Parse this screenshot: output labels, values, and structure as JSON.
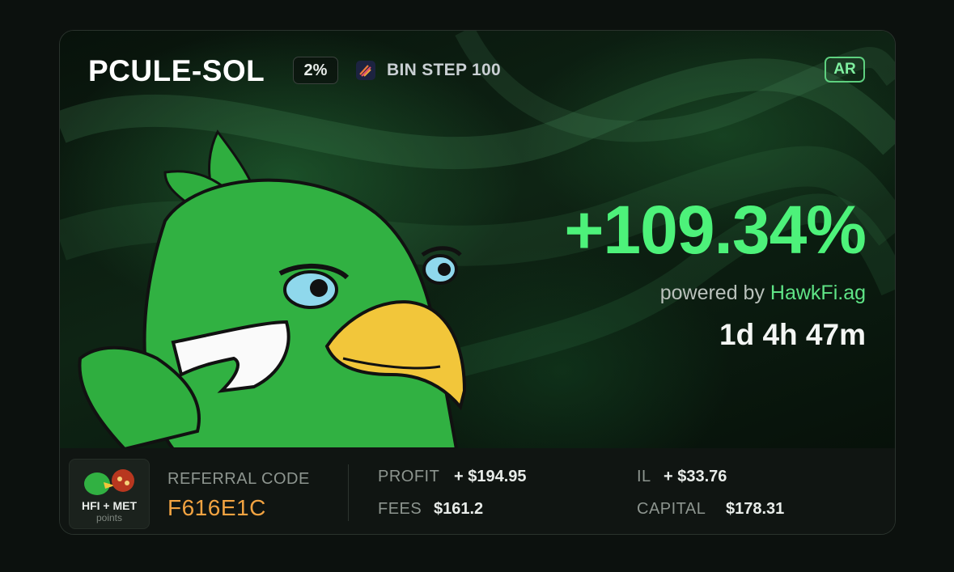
{
  "header": {
    "pair": "PCULE-SOL",
    "fee_badge": "2%",
    "bin_step": "BIN STEP 100",
    "ar_badge": "AR"
  },
  "hero": {
    "pnl_percent": "+109.34%",
    "powered_prefix": "powered by",
    "powered_brand": "HawkFi.ag",
    "duration": "1d 4h 47m"
  },
  "footer": {
    "points_title": "HFI + MET",
    "points_sub": "points",
    "referral_label": "REFERRAL CODE",
    "referral_code": "F616E1C",
    "stats": {
      "profit_label": "PROFIT",
      "profit_value": "+ $194.95",
      "fees_label": "FEES",
      "fees_value": "$161.2",
      "il_label": "IL",
      "il_value": "+ $33.76",
      "capital_label": "CAPITAL",
      "capital_value": "$178.31"
    }
  },
  "colors": {
    "accent_green": "#4df27a",
    "brand_green": "#5fe486",
    "referral_orange": "#f2a341"
  }
}
